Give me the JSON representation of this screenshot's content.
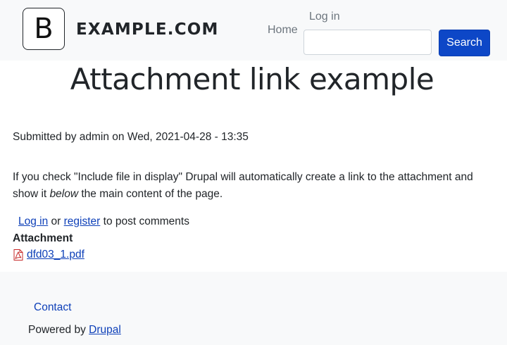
{
  "header": {
    "logo_letter": "B",
    "site_name": "EXAMPLE.COM",
    "nav": {
      "home": "Home",
      "login": "Log in"
    },
    "search": {
      "value": "",
      "button_label": "Search"
    }
  },
  "main": {
    "title": "Attachment link example",
    "submitted": "Submitted by admin on Wed, 2021-04-28 - 13:35",
    "body_part1": "If you check \"Include file in display\" Drupal will automatically create a link to the attachment and show it ",
    "body_em": "below",
    "body_part2": " the main content of the page.",
    "comment": {
      "login": "Log in",
      "or": " or ",
      "register": "register",
      "suffix": " to post comments"
    },
    "attachment_label": "Attachment",
    "attachment_file": "dfd03_1.pdf",
    "attachment_icon": "pdf-file-icon"
  },
  "footer": {
    "contact": "Contact",
    "powered_prefix": "Powered by ",
    "powered_link": "Drupal"
  },
  "colors": {
    "link": "#0d3fb8",
    "button": "#0d47c7",
    "header_bg": "#f8f9fa"
  }
}
